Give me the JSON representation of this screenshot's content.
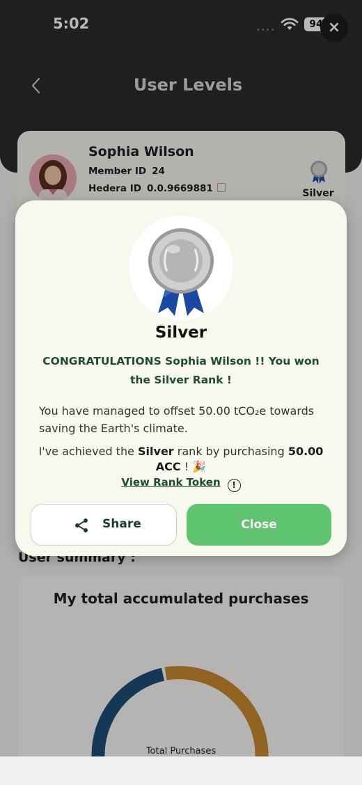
{
  "status_bar": {
    "time": "5:02",
    "signal": "••••",
    "battery": "94",
    "close_glyph": "×"
  },
  "header": {
    "title": "User Levels",
    "back_icon": "chevron-left-icon"
  },
  "profile": {
    "name": "Sophia Wilson",
    "member_id_label": "Member ID",
    "member_id": "24",
    "hedera_id_label": "Hedera ID",
    "hedera_id": "0.0.9669881",
    "rank_label": "Silver"
  },
  "summary": {
    "title": "User summary :",
    "chart_card_title": "My total accumulated purchases",
    "donut_center_label": "Total Purchases"
  },
  "modal": {
    "rank": "Silver",
    "congrats": "CONGRATULATIONS Sophia Wilson !! You won the Silver Rank !",
    "offset_text": "You have managed to offset 50.00 tCO₂e towards saving the Earth's climate.",
    "achieved_prefix": "I've achieved the ",
    "achieved_rank": "Silver",
    "achieved_middle": " rank by purchasing ",
    "achieved_amount": "50.00 ACC",
    "achieved_suffix": " ! 🎉",
    "view_token_link": "View Rank Token",
    "info_glyph": "!",
    "share_label": "Share",
    "close_label": "Close"
  },
  "colors": {
    "header_bg": "#2b2b2b",
    "accent_green": "#5ec46f",
    "dark_green_text": "#1f4d33",
    "donut_blue": "#1f4e79",
    "donut_orange": "#c98a2e"
  }
}
